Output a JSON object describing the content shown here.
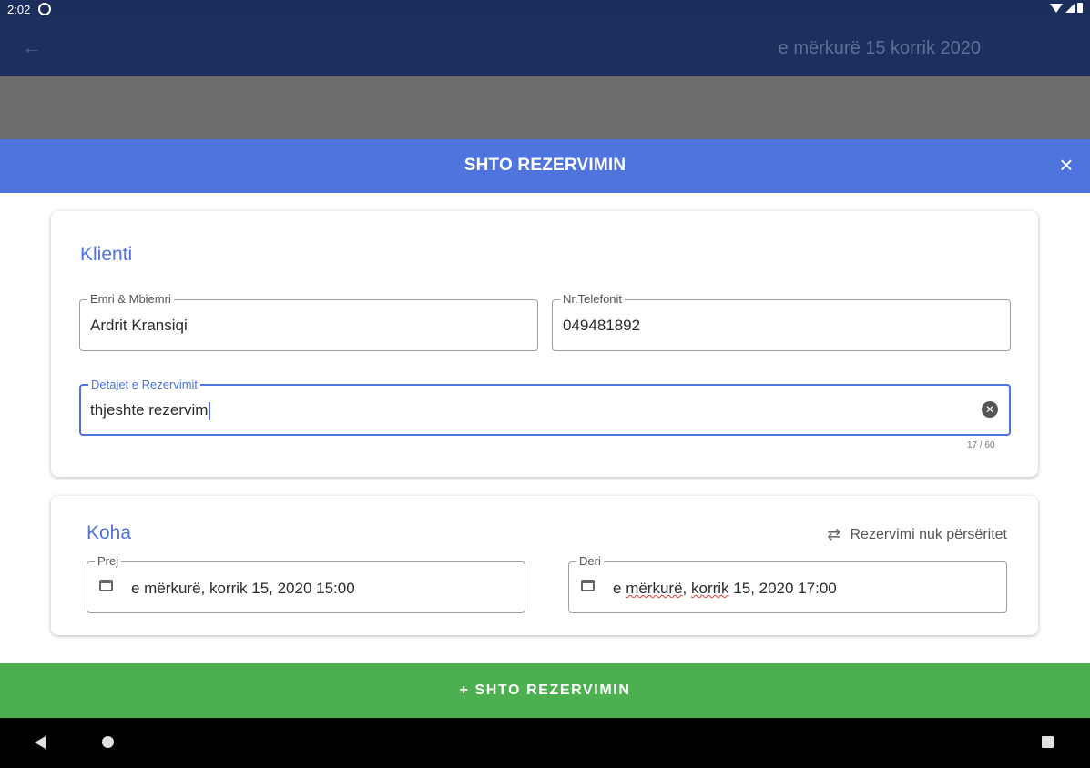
{
  "status_bar": {
    "time": "2:02",
    "app_icon": "notification-ring-icon",
    "icons": [
      "wifi-icon",
      "signal-icon",
      "battery-icon"
    ]
  },
  "app_bar": {
    "back_icon": "arrow-left-icon",
    "date": "e mërkurë 15 korrik 2020"
  },
  "dialog": {
    "title": "SHTO REZERVIMIN",
    "close_icon": "close-icon",
    "close_glyph": "×"
  },
  "client_section": {
    "title": "Klienti",
    "name_field": {
      "label": "Emri & Mbiemri",
      "value": "Ardrit Kransiqi"
    },
    "phone_field": {
      "label": "Nr.Telefonit",
      "value": "049481892"
    },
    "details_field": {
      "label": "Detajet e Rezervimit",
      "value": "thjeshte rezervim",
      "counter": "17 / 60",
      "clear_glyph": "✕"
    }
  },
  "time_section": {
    "title": "Koha",
    "repeat_label": "Rezervimi nuk përsëritet",
    "repeat_glyph": "⇄",
    "from_field": {
      "label": "Prej",
      "value": "e mërkurë, korrik 15, 2020   15:00"
    },
    "to_field": {
      "label": "Deri",
      "value_prefix": "e ",
      "value_word1": "mërkurë",
      "value_sep": ", ",
      "value_word2": "korrik",
      "value_rest": " 15, 2020   17:00"
    }
  },
  "submit_button": {
    "label": "+ SHTO REZERVIMIN"
  },
  "nav_bar": {
    "buttons": [
      "back",
      "home",
      "recents"
    ]
  },
  "colors": {
    "status_bar": "#1c2e5c",
    "app_bar": "#1d2f5e",
    "scrim": "#6c6c6c",
    "dialog_header": "#4f74dd",
    "accent": "#4f74dd",
    "submit": "#4caf50",
    "nav_bar": "#000000"
  }
}
